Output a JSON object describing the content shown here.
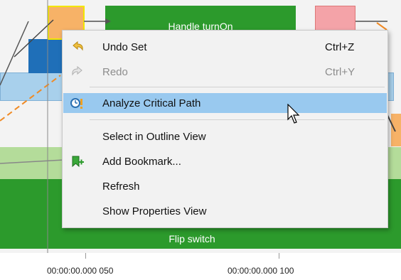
{
  "timeline": {
    "bars": [
      {
        "name": "Handle turnOn",
        "color": "#2c9a2c"
      },
      {
        "name": "Flip switch",
        "color": "#2c9a2c"
      }
    ]
  },
  "context_menu": {
    "items": [
      {
        "label": "Undo Set",
        "shortcut": "Ctrl+Z",
        "enabled": true,
        "icon": "undo-icon"
      },
      {
        "label": "Redo",
        "shortcut": "Ctrl+Y",
        "enabled": false,
        "icon": "redo-icon"
      },
      {
        "label": "Analyze Critical Path",
        "shortcut": "",
        "enabled": true,
        "selected": true,
        "icon": "critical-path-icon"
      },
      {
        "label": "Select in Outline View",
        "shortcut": "",
        "enabled": true,
        "icon": ""
      },
      {
        "label": "Add Bookmark...",
        "shortcut": "",
        "enabled": true,
        "icon": "add-bookmark-icon"
      },
      {
        "label": "Refresh",
        "shortcut": "",
        "enabled": true,
        "icon": ""
      },
      {
        "label": "Show Properties View",
        "shortcut": "",
        "enabled": true,
        "icon": ""
      }
    ]
  },
  "axis": {
    "ticks": [
      "00:00:00.000 050",
      "00:00:00.000 100"
    ]
  },
  "colors": {
    "selection": "#99c9ef",
    "green_bar": "#2c9a2c",
    "light_green": "#b4dc9a",
    "light_blue": "#a8d0ec",
    "blue": "#1f6fb8",
    "orange": "#f7b267",
    "pink": "#f4a3a8"
  }
}
